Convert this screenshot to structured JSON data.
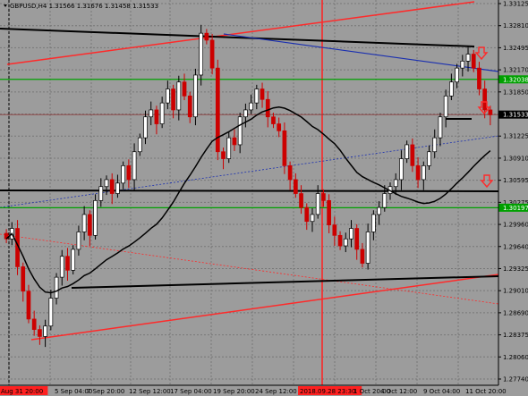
{
  "header": {
    "symbol_line": "GBPUSD,H4  1.31566 1.31676 1.31458 1.31533"
  },
  "colors": {
    "background": "#9c9c9c",
    "candle_up": "#000000",
    "candle_down": "#cc0000",
    "trend_red": "#ff2a2a",
    "trend_black": "#000000",
    "trend_blue": "#1a2fb0",
    "support_green": "#00a000",
    "price_line": "#8a3a3a",
    "highlight_bg": "#ff2020",
    "arrow_red": "#ff2a2a"
  },
  "price_axis": {
    "ticks": [
      "1.33125",
      "1.32810",
      "1.32495",
      "1.32170",
      "1.31850",
      "1.31533",
      "1.31225",
      "1.30910",
      "1.30595",
      "1.30275",
      "1.29960",
      "1.29640",
      "1.29325",
      "1.29010",
      "1.28690",
      "1.28375",
      "1.28060",
      "1.27740"
    ],
    "markers": [
      {
        "label": "1.32038",
        "color": "#00a000"
      },
      {
        "label": "1.31533",
        "color": "#000000"
      },
      {
        "label": "1.30197",
        "color": "#00a000"
      }
    ]
  },
  "time_axis": {
    "ticks": [
      "Aug 31 20:00",
      "5 Sep 04:00",
      "7 Sep 20:00",
      "12 Sep 12:00",
      "17 Sep 04:00",
      "19 Sep 20:00",
      "24 Sep 12:00",
      "2018.09.28 23:30",
      "1 Oct 20:00",
      "4 Oct 12:00",
      "9 Oct 04:00",
      "11 Oct 20:00"
    ],
    "highlighted": [
      "Aug 31 20:00",
      "2018.09.28 23:30"
    ]
  },
  "chart_data": {
    "type": "candlestick",
    "title": "GBPUSD,H4",
    "ohlc_readout": {
      "open": 1.31566,
      "high": 1.31676,
      "low": 1.31458,
      "close": 1.31533
    },
    "ylim": [
      1.2774,
      1.33125
    ],
    "close_series": [
      1.2975,
      1.299,
      1.2935,
      1.29,
      1.286,
      1.2845,
      1.2835,
      1.285,
      1.289,
      1.292,
      1.295,
      1.293,
      1.296,
      1.2985,
      1.301,
      1.298,
      1.303,
      1.305,
      1.306,
      1.304,
      1.3055,
      1.308,
      1.306,
      1.31,
      1.312,
      1.315,
      1.316,
      1.314,
      1.317,
      1.319,
      1.316,
      1.32,
      1.318,
      1.315,
      1.321,
      1.327,
      1.326,
      1.322,
      1.31,
      1.309,
      1.312,
      1.311,
      1.315,
      1.316,
      1.317,
      1.319,
      1.3175,
      1.315,
      1.314,
      1.313,
      1.308,
      1.306,
      1.304,
      1.302,
      1.3,
      1.301,
      1.304,
      1.303,
      1.2995,
      1.298,
      1.2965,
      1.2975,
      1.299,
      1.296,
      1.294,
      1.2985,
      1.301,
      1.302,
      1.304,
      1.305,
      1.306,
      1.309,
      1.311,
      1.308,
      1.306,
      1.308,
      1.31,
      1.312,
      1.315,
      1.318,
      1.32,
      1.322,
      1.323,
      1.324,
      1.322,
      1.319,
      1.316,
      1.3153
    ],
    "horizontal_levels": [
      {
        "price": 1.32038,
        "color": "#00a000"
      },
      {
        "price": 1.30197,
        "color": "#00a000"
      },
      {
        "price": 1.31533,
        "color": "#8a3a3a"
      }
    ]
  }
}
